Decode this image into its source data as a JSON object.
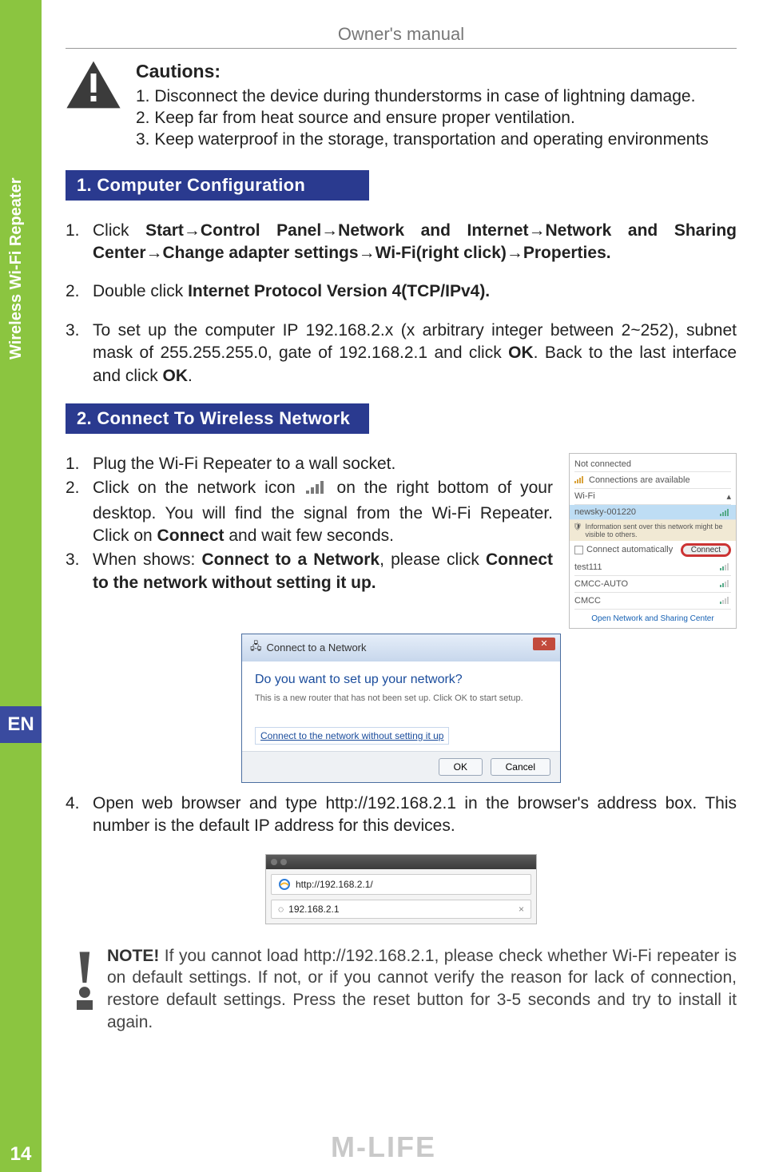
{
  "header": {
    "title": "Owner's manual"
  },
  "sidebar": {
    "label": "Wireless Wi-Fi Repeater",
    "lang": "EN",
    "page": "14"
  },
  "cautions": {
    "title": "Cautions:",
    "items": [
      "1. Disconnect the device during thunderstorms in case of lightning damage.",
      "2. Keep far from heat source and ensure proper ventilation.",
      "3. Keep waterproof in the storage, transportation and operating environments"
    ]
  },
  "section1": {
    "heading": "1. Computer Configuration",
    "step1_num": "1.",
    "step1_a": "Click ",
    "step1_b": "Start→Control Panel→Network and Internet→Network and Sharing Center→Change adapter settings→Wi-Fi(right click)→Properties.",
    "step2_num": "2.",
    "step2_a": "Double click ",
    "step2_b": "Internet Protocol Version 4(TCP/IPv4).",
    "step3_num": "3.",
    "step3_a": "To set up the computer IP 192.168.2.x (x arbitrary integer between 2~252), subnet mask of 255.255.255.0, gate of 192.168.2.1 and click ",
    "step3_b": "OK",
    "step3_c": ". Back to the last interface and click ",
    "step3_d": "OK",
    "step3_e": "."
  },
  "section2": {
    "heading": "2. Connect To Wireless Network",
    "s1_num": "1.",
    "s1": "Plug the Wi-Fi Repeater to a wall socket.",
    "s2_num": "2.",
    "s2_a": "Click on the network icon ",
    "s2_b": " on the right bottom of your desktop. You will find the signal from the Wi-Fi Repeater. Click on ",
    "s2_c": "Connect",
    "s2_d": " and wait few seconds.",
    "s3_num": "3.",
    "s3_a": "When shows: ",
    "s3_b": "Connect to a Network",
    "s3_c": ", please click ",
    "s3_d": "Connect to the network without setting it up.",
    "s4_num": "4.",
    "s4": "Open web browser and type http://192.168.2.1 in the browser's address box. This number is the default IP address for this devices."
  },
  "wifi_popup": {
    "not_connected": "Not connected",
    "avail": "Connections are available",
    "wifi": "Wi-Fi",
    "ssid": "newsky-001220",
    "info": "Information sent over this network might be visible to others.",
    "auto": "Connect automatically",
    "connect": "Connect",
    "n1": "test111",
    "n2": "CMCC-AUTO",
    "n3": "CMCC",
    "link": "Open Network and Sharing Center"
  },
  "dialog": {
    "title": "Connect to a Network",
    "q": "Do you want to set up your network?",
    "sub": "This is a new router that has not been set up. Click OK to start setup.",
    "link": "Connect to the network without setting it up",
    "ok": "OK",
    "cancel": "Cancel"
  },
  "addr": {
    "url": "http://192.168.2.1/",
    "tab": "192.168.2.1"
  },
  "note": {
    "label": "NOTE!",
    "text": " If you cannot load http://192.168.2.1, please check whether Wi-Fi repeater is on default settings. If not, or if you cannot verify the reason for lack of connection, restore default settings. Press the reset button for 3-5 seconds and try to install it again."
  },
  "footer": {
    "logo": "M-LIFE"
  }
}
